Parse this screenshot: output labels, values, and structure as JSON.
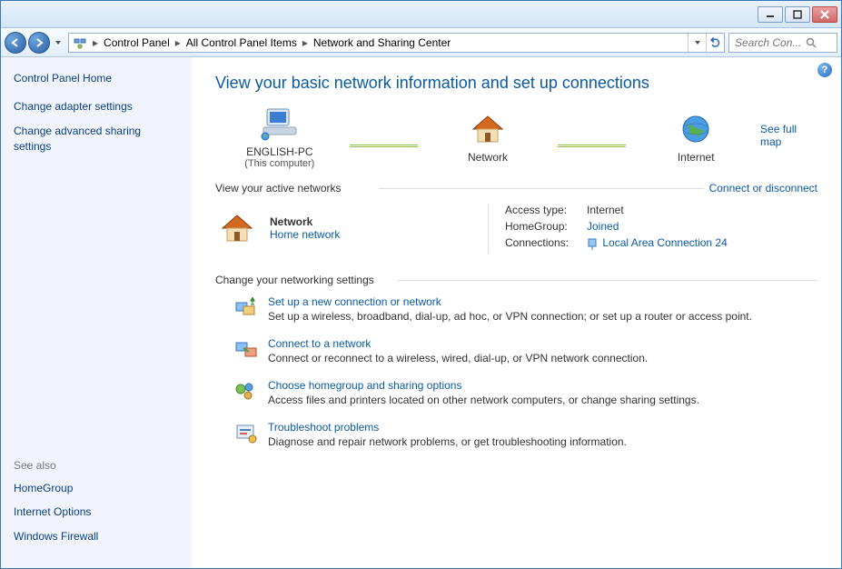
{
  "titlebar": {
    "minimize": "minimize",
    "maximize": "maximize",
    "close": "close"
  },
  "breadcrumb": {
    "root": "Control Panel",
    "mid": "All Control Panel Items",
    "leaf": "Network and Sharing Center"
  },
  "search": {
    "placeholder": "Search Con..."
  },
  "sidebar": {
    "home": "Control Panel Home",
    "links": {
      "adapter": "Change adapter settings",
      "advanced": "Change advanced sharing settings"
    },
    "seealso_label": "See also",
    "seealso": {
      "homegroup": "HomeGroup",
      "internet": "Internet Options",
      "firewall": "Windows Firewall"
    }
  },
  "main": {
    "title": "View your basic network information and set up connections",
    "see_full_map": "See full map",
    "map": {
      "pc_name": "ENGLISH-PC",
      "pc_sub": "(This computer)",
      "network_label": "Network",
      "internet_label": "Internet"
    },
    "active_label": "View your active networks",
    "connect_disconnect": "Connect or disconnect",
    "active": {
      "name": "Network",
      "type": "Home network",
      "access_k": "Access type:",
      "access_v": "Internet",
      "homegroup_k": "HomeGroup:",
      "homegroup_v": "Joined",
      "conn_k": "Connections:",
      "conn_v": "Local Area Connection 24"
    },
    "change_label": "Change your networking settings",
    "tasks": {
      "t1_title": "Set up a new connection or network",
      "t1_desc": "Set up a wireless, broadband, dial-up, ad hoc, or VPN connection; or set up a router or access point.",
      "t2_title": "Connect to a network",
      "t2_desc": "Connect or reconnect to a wireless, wired, dial-up, or VPN network connection.",
      "t3_title": "Choose homegroup and sharing options",
      "t3_desc": "Access files and printers located on other network computers, or change sharing settings.",
      "t4_title": "Troubleshoot problems",
      "t4_desc": "Diagnose and repair network problems, or get troubleshooting information."
    }
  }
}
